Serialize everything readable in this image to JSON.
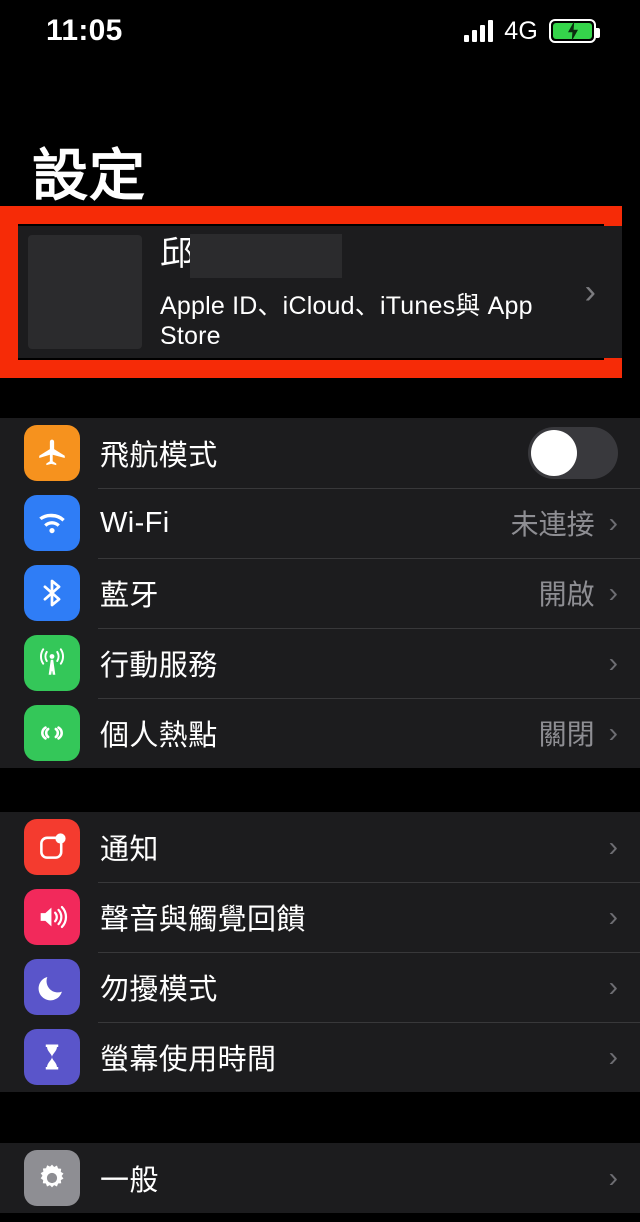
{
  "status_bar": {
    "time": "11:05",
    "network": "4G",
    "signal_bars": 4,
    "battery_charging": true,
    "signal_icon": "cellular-signal-icon",
    "battery_icon": "battery-charging-icon"
  },
  "header": {
    "title": "設定"
  },
  "highlight": {
    "color": "#f62b07",
    "target": "apple-id-row"
  },
  "apple_id": {
    "name": "邱",
    "name_redacted": true,
    "subtitle": "Apple ID、iCloud、iTunes與 App Store",
    "chevron": "›",
    "avatar_icon": "avatar-placeholder"
  },
  "groups": [
    {
      "id": "connectivity",
      "rows": [
        {
          "label": "飛航模式",
          "icon": "airplane-icon",
          "icon_color": "#f6921e",
          "control": "toggle",
          "toggle_on": false
        },
        {
          "label": "Wi-Fi",
          "icon": "wifi-icon",
          "icon_color": "#2f7df6",
          "control": "chevron",
          "value": "未連接",
          "chevron": "›"
        },
        {
          "label": "藍牙",
          "icon": "bluetooth-icon",
          "icon_color": "#2f7df6",
          "control": "chevron",
          "value": "開啟",
          "chevron": "›"
        },
        {
          "label": "行動服務",
          "icon": "cellular-icon",
          "icon_color": "#34c759",
          "control": "chevron",
          "value": "",
          "chevron": "›"
        },
        {
          "label": "個人熱點",
          "icon": "hotspot-icon",
          "icon_color": "#34c759",
          "control": "chevron",
          "value": "關閉",
          "chevron": "›"
        }
      ]
    },
    {
      "id": "alerts",
      "rows": [
        {
          "label": "通知",
          "icon": "notifications-icon",
          "icon_color": "#f43b2f",
          "control": "chevron",
          "value": "",
          "chevron": "›"
        },
        {
          "label": "聲音與觸覺回饋",
          "icon": "sounds-haptics-icon",
          "icon_color": "#f2295b",
          "control": "chevron",
          "value": "",
          "chevron": "›"
        },
        {
          "label": "勿擾模式",
          "icon": "do-not-disturb-icon",
          "icon_color": "#5a55ca",
          "control": "chevron",
          "value": "",
          "chevron": "›"
        },
        {
          "label": "螢幕使用時間",
          "icon": "screen-time-icon",
          "icon_color": "#5a55ca",
          "control": "chevron",
          "value": "",
          "chevron": "›"
        }
      ]
    },
    {
      "id": "system",
      "rows": [
        {
          "label": "一般",
          "icon": "gear-icon",
          "icon_color": "#8e8e93",
          "control": "chevron",
          "value": "",
          "chevron": "›"
        }
      ]
    }
  ]
}
